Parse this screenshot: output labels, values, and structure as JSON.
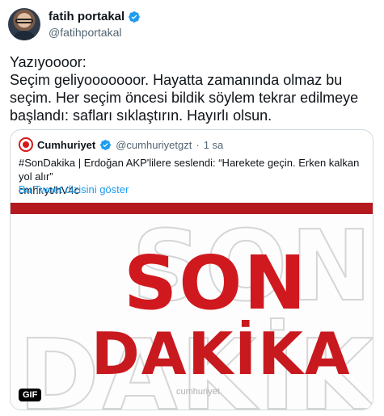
{
  "author": {
    "name": "fatih portakal",
    "handle": "@fatihportakal"
  },
  "tweet": {
    "lines": [
      "Yazıyoooor:",
      "Seçim geliyooooooor. Hayatta zamanında olmaz bu",
      "seçim. Her seçim öncesi bildik söylem tekrar edilmeye",
      "başlandı: safları sıklaştırın. Hayırlı olsun."
    ]
  },
  "quote": {
    "name": "Cumhuriyet",
    "handle": "@cumhuriyetgzt",
    "separator": "·",
    "time": "1 sa",
    "text_line1": "#SonDakika | Erdoğan AKP'lilere seslendi: “Harekete geçin. Erken kalkan yol alır”",
    "text_line2": "cmhr.yt/hV4c",
    "thread_link": "Bu Tweet dizisini göster"
  },
  "media": {
    "word1": "SON",
    "word2": "DAKİKA",
    "watermark": "cumhuriyet",
    "badge": "GIF",
    "accent_color": "#d0191f"
  },
  "colors": {
    "verified": "#1d9bf0",
    "link": "#1d9bf0",
    "muted": "#536471"
  }
}
